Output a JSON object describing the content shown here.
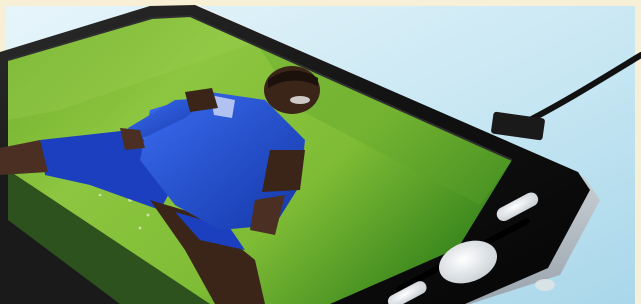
{
  "image": {
    "subject": "smartphone",
    "colors": {
      "frame_top": "#f7efd6",
      "background_light": "#e3f3fb",
      "background_mid": "#b9dfee",
      "phone_body": "#141414",
      "phone_bezel": "#2a2a2a",
      "phone_rim": "#d7dbe0",
      "screen_grass_light": "#8cc63f",
      "screen_grass_dark": "#2f7d1b",
      "jersey_blue": "#1e4fd8",
      "skin": "#4a2f22",
      "button_white": "#f4f6f7",
      "cable": "#111111"
    }
  }
}
